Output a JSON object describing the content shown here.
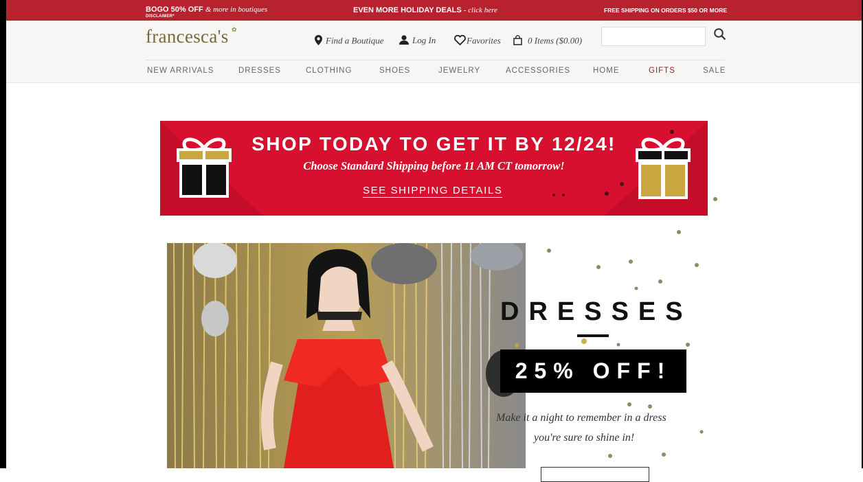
{
  "promo_bar": {
    "left_text": "BOGO 50% OFF",
    "left_text_italic": "& more in boutiques",
    "disclaimer": "DISCLAIMER*",
    "center_text": "EVEN MORE HOLIDAY DEALS",
    "center_text_italic": "- click here",
    "right_text": "FREE SHIPPING ON ORDERS $50 OR MORE",
    "background": "#b8222f"
  },
  "header": {
    "logo": "francesca's",
    "links": {
      "find_boutique": "Find a Boutique",
      "log_in": "Log In",
      "favorites": "Favorites",
      "cart": "0 Items ($0.00)"
    },
    "search": {
      "placeholder": "",
      "value": ""
    },
    "icons": [
      "map-pin-icon",
      "user-icon",
      "heart-icon",
      "shopping-bag-icon",
      "search-icon"
    ]
  },
  "nav": {
    "items": [
      {
        "label": "NEW ARRIVALS"
      },
      {
        "label": "DRESSES"
      },
      {
        "label": "CLOTHING"
      },
      {
        "label": "SHOES"
      },
      {
        "label": "JEWELRY"
      },
      {
        "label": "ACCESSORIES"
      },
      {
        "label": "HOME"
      },
      {
        "label": "GIFTS",
        "color": "#9a1b2a"
      },
      {
        "label": "SALE"
      }
    ]
  },
  "shipping_banner": {
    "headline": "SHOP TODAY TO GET IT BY 12/24!",
    "subline": "Choose Standard Shipping before 11 AM CT tomorrow!",
    "cta": "SEE SHIPPING DETAILS",
    "background": "#d8102f",
    "icons": [
      "gift-box-icon",
      "gift-box-icon"
    ]
  },
  "hero": {
    "title": "DRESSES",
    "discount": "25% OFF!",
    "tagline_line1": "Make it a night to remember in a dress",
    "tagline_line2": "you're sure to shine in!"
  },
  "colors": {
    "accent": "#9a1b2a",
    "logo": "#7a6a36",
    "gold": "#c9a640"
  }
}
